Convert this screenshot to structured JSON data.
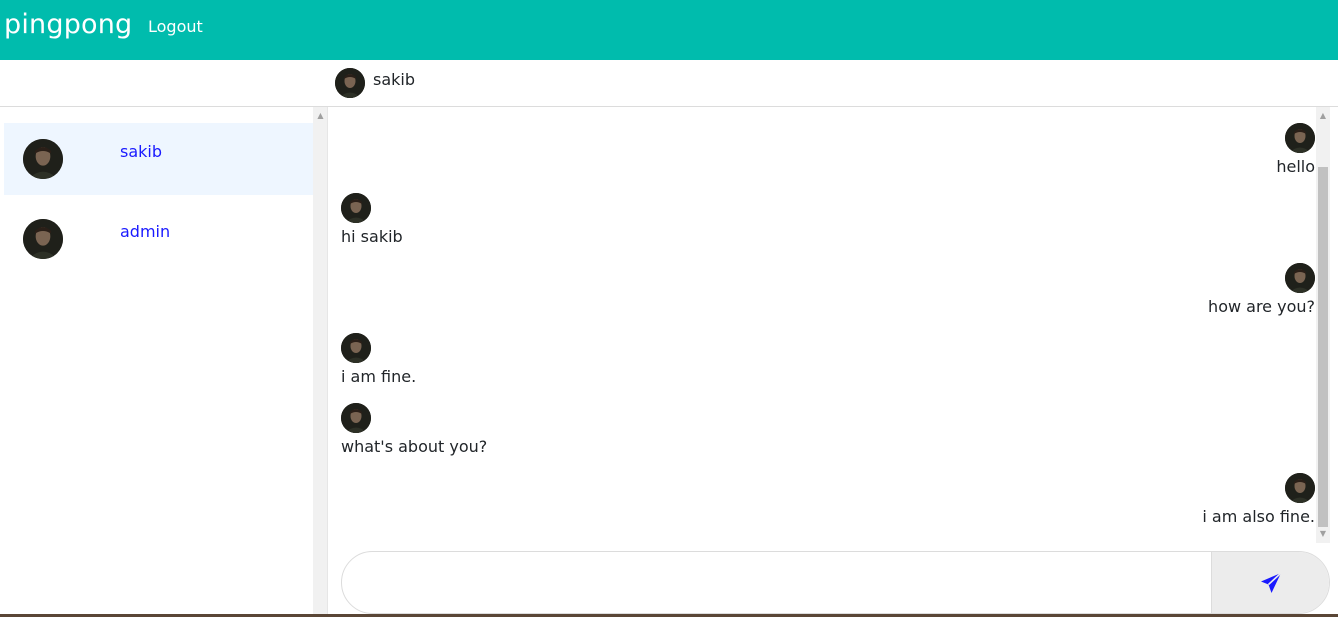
{
  "app": {
    "brand": "pingpong",
    "logout_label": "Logout"
  },
  "chat_header": {
    "name": "sakib"
  },
  "contacts": [
    {
      "name": "sakib",
      "active": true
    },
    {
      "name": "admin",
      "active": false
    }
  ],
  "messages": [
    {
      "text": "hello",
      "direction": "out"
    },
    {
      "text": "hi sakib",
      "direction": "in"
    },
    {
      "text": "how are you?",
      "direction": "out"
    },
    {
      "text": "i am fine.",
      "direction": "in"
    },
    {
      "text": "what's about you?",
      "direction": "in"
    },
    {
      "text": "i am also fine.",
      "direction": "out"
    }
  ],
  "composer": {
    "value": "",
    "placeholder": "",
    "send_icon": "paper-plane-icon"
  },
  "colors": {
    "navbar": "#00bcad",
    "link": "#1a1aff",
    "active_contact": "#eef6ff",
    "send_icon": "#1a1aff"
  }
}
